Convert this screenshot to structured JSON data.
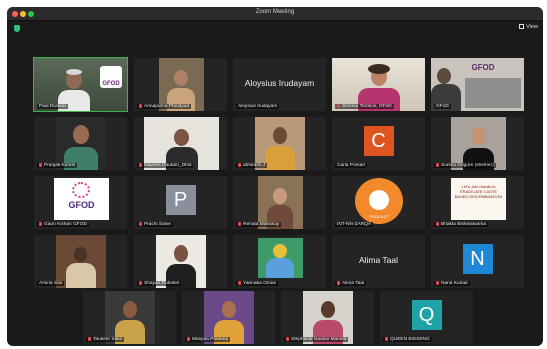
{
  "window": {
    "title": "Zoom Meeting",
    "view_label": "View"
  },
  "participants": [
    "Paul Divakar",
    "Annapurna Pfaridyud",
    "Aloysius Irudayam",
    "Simona Torotcoi, GFoD",
    "GFoD",
    "Pranjali Kureel",
    "Naveen Gautam_Dhol",
    "abhirami J",
    "Carla Pomarl",
    "Sunina Grigore (she/her)",
    "Gaon Kishan GFOD",
    "Prachi Salve",
    "Renata Mahasay",
    "INT-NN-ZARQA",
    "Bhakta Bishwakarma",
    "Amina Sali",
    "Shayan Robiden",
    "Yannaba Oman",
    "Alima Taal",
    "Nand Kumar",
    "Taukeer Sakil",
    "Manjula Pradeep",
    "Stéphanie Nadine Mamba",
    "QUEEN BISSENG"
  ],
  "tiles": {
    "aloysius_big": "Aloysius Irudayam",
    "alima_big": "Alima Taal",
    "carla_initial": "C",
    "prachi_initial": "P",
    "nand_initial": "N",
    "queen_initial": "Q",
    "gfod_logo_text": "GFOD",
    "poster_text": "Let's Join Hands to ERADICATE CASTE BASED DISCRIMINATION",
    "podcast_label": "PODCAST"
  },
  "colors": {
    "window_bg": "#1a1a1a",
    "tile_bg": "#242424",
    "active_speaker": "#3bb54a",
    "carla_avatar": "#e0541f",
    "prachi_avatar": "#8a8f9c",
    "nand_avatar": "#1e88d6",
    "queen_avatar": "#1fa3a8"
  }
}
